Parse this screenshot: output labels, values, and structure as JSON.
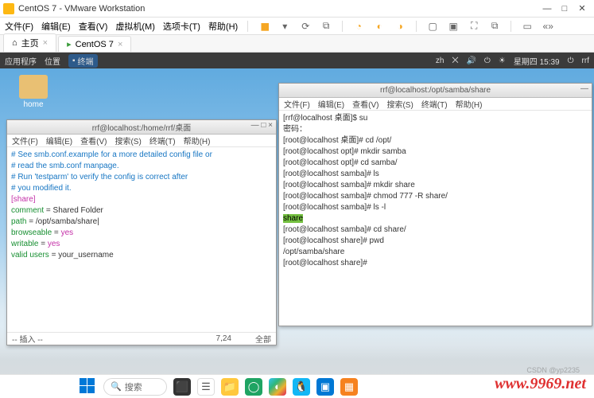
{
  "vmware": {
    "title": "CentOS 7 - VMware Workstation",
    "menu": {
      "file": "文件(F)",
      "edit": "编辑(E)",
      "view": "查看(V)",
      "vm": "虚拟机(M)",
      "tabs": "选项卡(T)",
      "help": "帮助(H)"
    },
    "tabs": {
      "home": "主页",
      "vm": "CentOS 7"
    }
  },
  "gnome": {
    "apps": "应用程序",
    "places": "位置",
    "terminal": "终端",
    "lang": "zh",
    "clock": "星期四 15:39",
    "user": "rrf"
  },
  "desktop": {
    "home_label": "home"
  },
  "term_left": {
    "title": "rrf@localhost:/home/rrf/桌面",
    "menu": {
      "file": "文件(F)",
      "edit": "编辑(E)",
      "view": "查看(V)",
      "search": "搜索(S)",
      "terminal": "终端(T)",
      "help": "帮助(H)"
    },
    "lines": {
      "c1": "# See smb.conf.example for a more detailed config file or",
      "c2": "# read the smb.conf manpage.",
      "c3": "# Run 'testparm' to verify the config is correct after",
      "c4": "# you modified it.",
      "sect": "[share]",
      "l1a": "comment",
      "l1b": " = Shared Folder",
      "l2a": "path",
      "l2b": " = /opt/samba/share",
      "cursor": "|",
      "l3a": "browseable",
      "l3b": " = ",
      "l3c": "yes",
      "l4a": "writable",
      "l4b": " = ",
      "l4c": "yes",
      "l5a": "valid users",
      "l5b": " = your_username"
    },
    "status": {
      "mode": "-- 插入 --",
      "pos": "7,24",
      "scroll": "全部"
    }
  },
  "term_right": {
    "title": "rrf@localhost:/opt/samba/share",
    "menu": {
      "file": "文件(F)",
      "edit": "编辑(E)",
      "view": "查看(V)",
      "search": "搜索(S)",
      "terminal": "终端(T)",
      "help": "帮助(H)"
    },
    "lines": {
      "l1": "[rrf@localhost 桌面]$ su",
      "l2": "密码：",
      "l3": "[root@localhost 桌面]# cd /opt/",
      "l4": "[root@localhost opt]# mkdir samba",
      "l5": "[root@localhost opt]# cd samba/",
      "l6": "[root@localhost samba]# ls",
      "l7": "[root@localhost samba]# mkdir share",
      "l8": "[root@localhost samba]# chmod 777 -R share/",
      "l9": "[root@localhost samba]# ls -l",
      "hl": "share",
      "l10": "[root@localhost samba]# cd share/",
      "l11": "[root@localhost share]# pwd",
      "l12": "/opt/samba/share",
      "l13": "[root@localhost share]# "
    }
  },
  "taskbar": {
    "search": "搜索"
  },
  "watermark": "www.9969.net",
  "csdn": "CSDN @yp2235"
}
